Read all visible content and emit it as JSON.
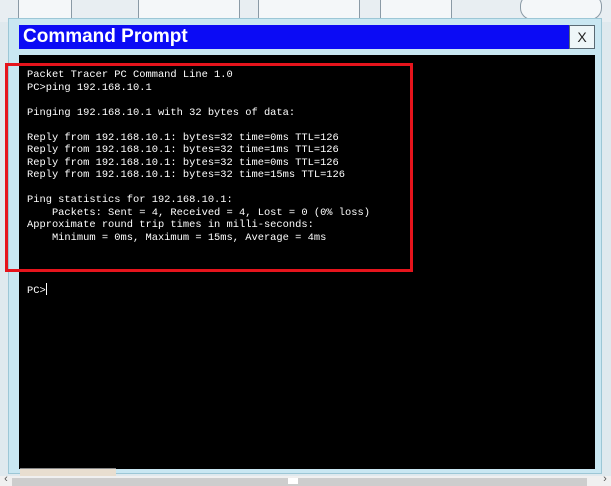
{
  "window": {
    "title": "Command Prompt",
    "close_label": "X"
  },
  "terminal": {
    "output": "Packet Tracer PC Command Line 1.0\nPC>ping 192.168.10.1\n\nPinging 192.168.10.1 with 32 bytes of data:\n\nReply from 192.168.10.1: bytes=32 time=0ms TTL=126\nReply from 192.168.10.1: bytes=32 time=1ms TTL=126\nReply from 192.168.10.1: bytes=32 time=0ms TTL=126\nReply from 192.168.10.1: bytes=32 time=15ms TTL=126\n\nPing statistics for 192.168.10.1:\n    Packets: Sent = 4, Received = 4, Lost = 0 (0% loss)\nApproximate round trip times in milli-seconds:\n    Minimum = 0ms, Maximum = 15ms, Average = 4ms",
    "prompt": "PC>"
  },
  "scrollbar": {
    "left_arrow": "‹",
    "right_arrow": "›"
  },
  "colors": {
    "titlebar": "#0b0bf5",
    "terminal_bg": "#000000",
    "highlight": "#e6141c",
    "window_bg": "#c9e7f2"
  },
  "icons": [
    "close-icon",
    "scroll-left-icon",
    "scroll-right-icon"
  ]
}
